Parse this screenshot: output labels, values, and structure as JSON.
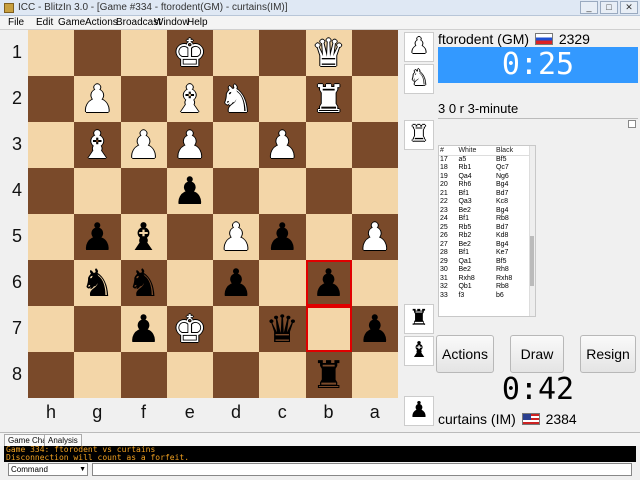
{
  "window": {
    "title": "ICC - BlitzIn 3.0 - [Game #334 - ftorodent(GM) - curtains(IM)]"
  },
  "menu": [
    "File",
    "Edit",
    "Game",
    "Actions",
    "Broadcast",
    "Window",
    "Help"
  ],
  "board": {
    "ranks": [
      "1",
      "2",
      "3",
      "4",
      "5",
      "6",
      "7",
      "8"
    ],
    "files": [
      "h",
      "g",
      "f",
      "e",
      "d",
      "c",
      "b",
      "a"
    ],
    "pieces": [
      {
        "file": 3,
        "rank": 0,
        "glyph": "♚",
        "color": "w",
        "name": "white-king-piece"
      },
      {
        "file": 6,
        "rank": 0,
        "glyph": "♛",
        "color": "w",
        "name": "white-queen-piece"
      },
      {
        "file": 1,
        "rank": 1,
        "glyph": "♟",
        "color": "w",
        "name": "white-pawn-piece"
      },
      {
        "file": 3,
        "rank": 1,
        "glyph": "♝",
        "color": "w",
        "name": "white-bishop-piece"
      },
      {
        "file": 4,
        "rank": 1,
        "glyph": "♞",
        "color": "w",
        "name": "white-knight-piece"
      },
      {
        "file": 6,
        "rank": 1,
        "glyph": "♜",
        "color": "w",
        "name": "white-rook-piece"
      },
      {
        "file": 1,
        "rank": 2,
        "glyph": "♝",
        "color": "w",
        "name": "white-bishop-piece"
      },
      {
        "file": 2,
        "rank": 2,
        "glyph": "♟",
        "color": "w",
        "name": "white-pawn-piece"
      },
      {
        "file": 3,
        "rank": 2,
        "glyph": "♟",
        "color": "w",
        "name": "white-pawn-piece"
      },
      {
        "file": 5,
        "rank": 2,
        "glyph": "♟",
        "color": "w",
        "name": "white-pawn-piece"
      },
      {
        "file": 3,
        "rank": 3,
        "glyph": "♟",
        "color": "b",
        "name": "black-pawn-piece"
      },
      {
        "file": 1,
        "rank": 4,
        "glyph": "♟",
        "color": "b",
        "name": "black-pawn-piece"
      },
      {
        "file": 2,
        "rank": 4,
        "glyph": "♝",
        "color": "b",
        "name": "black-bishop-piece"
      },
      {
        "file": 4,
        "rank": 4,
        "glyph": "♟",
        "color": "w",
        "name": "white-pawn-piece"
      },
      {
        "file": 5,
        "rank": 4,
        "glyph": "♟",
        "color": "b",
        "name": "black-pawn-piece"
      },
      {
        "file": 7,
        "rank": 4,
        "glyph": "♟",
        "color": "w",
        "name": "white-pawn-piece"
      },
      {
        "file": 1,
        "rank": 5,
        "glyph": "♞",
        "color": "b",
        "name": "black-knight-piece"
      },
      {
        "file": 2,
        "rank": 5,
        "glyph": "♞",
        "color": "b",
        "name": "black-knight-piece"
      },
      {
        "file": 4,
        "rank": 5,
        "glyph": "♟",
        "color": "b",
        "name": "black-pawn-piece"
      },
      {
        "file": 6,
        "rank": 5,
        "glyph": "♟",
        "color": "b",
        "name": "black-pawn-piece"
      },
      {
        "file": 2,
        "rank": 6,
        "glyph": "♟",
        "color": "b",
        "name": "black-pawn-piece"
      },
      {
        "file": 3,
        "rank": 6,
        "glyph": "♚",
        "color": "w",
        "name": "white-king-piece"
      },
      {
        "file": 5,
        "rank": 6,
        "glyph": "♛",
        "color": "b",
        "name": "black-queen-piece"
      },
      {
        "file": 7,
        "rank": 6,
        "glyph": "♟",
        "color": "b",
        "name": "black-pawn-piece"
      },
      {
        "file": 6,
        "rank": 7,
        "glyph": "♜",
        "color": "b",
        "name": "black-rook-piece"
      }
    ],
    "highlight_squares": [
      {
        "file": 6,
        "rank": 5
      },
      {
        "file": 6,
        "rank": 6
      }
    ],
    "highlight_color": "#e00000",
    "light_color": "#f3d6a8",
    "dark_color": "#7a4a2a"
  },
  "captured_strip": {
    "top": [
      {
        "glyph": "♟",
        "color": "w",
        "name": "captured-white-pawn-icon"
      },
      {
        "glyph": "♞",
        "color": "w",
        "name": "captured-white-knight-icon"
      },
      {
        "glyph": "♜",
        "color": "w",
        "name": "captured-white-rook-icon"
      }
    ],
    "bottom": [
      {
        "glyph": "♜",
        "color": "b",
        "name": "captured-black-rook-icon"
      },
      {
        "glyph": "♝",
        "color": "b",
        "name": "captured-black-bishop-icon"
      },
      {
        "glyph": "♟",
        "color": "b",
        "name": "captured-black-pawn-icon"
      }
    ]
  },
  "top_player": {
    "name": "ftorodent (GM)",
    "rating": "2329",
    "clock": "0:25",
    "flag_icon": "russia-flag-icon"
  },
  "bottom_player": {
    "name": "curtains (IM)",
    "rating": "2384",
    "clock": "0:42",
    "flag_icon": "usa-flag-icon"
  },
  "game_type": "3 0 r 3-minute",
  "moves": {
    "headers": [
      "#",
      "White",
      "Black"
    ],
    "rows": [
      [
        "17",
        "a5",
        "Bf5"
      ],
      [
        "18",
        "Rb1",
        "Qc7"
      ],
      [
        "19",
        "Qa4",
        "Ng6"
      ],
      [
        "20",
        "Rh6",
        "Bg4"
      ],
      [
        "21",
        "Bf1",
        "Bd7"
      ],
      [
        "22",
        "Qa3",
        "Kc8"
      ],
      [
        "23",
        "Be2",
        "Bg4"
      ],
      [
        "24",
        "Bf1",
        "Rb8"
      ],
      [
        "25",
        "Rb5",
        "Bd7"
      ],
      [
        "26",
        "Rb2",
        "Kd8"
      ],
      [
        "27",
        "Be2",
        "Bg4"
      ],
      [
        "28",
        "Bf1",
        "Ke7"
      ],
      [
        "29",
        "Qa1",
        "Bf5"
      ],
      [
        "30",
        "Be2",
        "Rh8"
      ],
      [
        "31",
        "Rxh8",
        "Rxh8"
      ],
      [
        "32",
        "Qb1",
        "Rb8"
      ],
      [
        "33",
        "f3",
        "b6"
      ]
    ]
  },
  "buttons": {
    "actions": "Actions",
    "draw": "Draw",
    "resign": "Resign"
  },
  "bottom_tabs": [
    "Game Chat",
    "Analysis"
  ],
  "console_lines": [
    "Game 334: ftorodent vs curtains",
    "Disconnection will count as a forfeit."
  ],
  "command": {
    "selected": "Command"
  }
}
